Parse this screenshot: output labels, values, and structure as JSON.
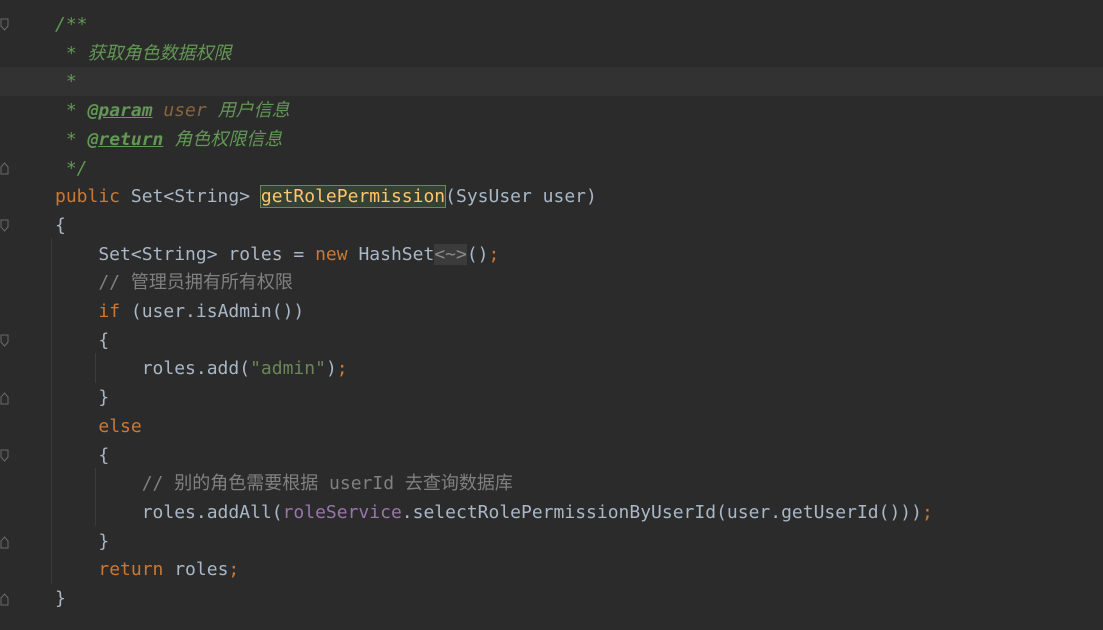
{
  "editor": {
    "lines": [
      {
        "tokens": [
          {
            "t": "/**",
            "c": "doc"
          }
        ]
      },
      {
        "tokens": [
          {
            "t": " * 获取角色数据权限",
            "c": "doc"
          }
        ]
      },
      {
        "tokens": [
          {
            "t": " *",
            "c": "doc"
          }
        ]
      },
      {
        "tokens": [
          {
            "t": " * ",
            "c": "doc"
          },
          {
            "t": "@param",
            "c": "doc-tag"
          },
          {
            "t": " user",
            "c": "doc-param"
          },
          {
            "t": " 用户信息",
            "c": "doc"
          }
        ]
      },
      {
        "tokens": [
          {
            "t": " * ",
            "c": "doc"
          },
          {
            "t": "@return",
            "c": "doc-tag"
          },
          {
            "t": " 角色权限信息",
            "c": "doc"
          }
        ]
      },
      {
        "tokens": [
          {
            "t": " */",
            "c": "doc"
          }
        ]
      },
      {
        "tokens": [
          {
            "t": "public ",
            "c": "kw"
          },
          {
            "t": "Set<String> ",
            "c": "plain"
          },
          {
            "t": "getRolePermission",
            "c": "method-hl"
          },
          {
            "t": "(SysUser user)",
            "c": "plain"
          }
        ]
      },
      {
        "tokens": [
          {
            "t": "{",
            "c": "plain"
          }
        ]
      },
      {
        "tokens": [
          {
            "t": "    Set<String> roles = ",
            "c": "plain"
          },
          {
            "t": "new ",
            "c": "kw"
          },
          {
            "t": "HashSet",
            "c": "plain"
          },
          {
            "t": "<~>",
            "c": "diamond"
          },
          {
            "t": "()",
            "c": "plain"
          },
          {
            "t": ";",
            "c": "semi"
          }
        ]
      },
      {
        "tokens": [
          {
            "t": "    // 管理员拥有所有权限",
            "c": "comment"
          }
        ]
      },
      {
        "tokens": [
          {
            "t": "    ",
            "c": "plain"
          },
          {
            "t": "if ",
            "c": "kw"
          },
          {
            "t": "(user.isAdmin())",
            "c": "plain"
          }
        ]
      },
      {
        "tokens": [
          {
            "t": "    {",
            "c": "plain"
          }
        ]
      },
      {
        "tokens": [
          {
            "t": "        roles.add(",
            "c": "plain"
          },
          {
            "t": "\"admin\"",
            "c": "str"
          },
          {
            "t": ")",
            "c": "plain"
          },
          {
            "t": ";",
            "c": "semi"
          }
        ]
      },
      {
        "tokens": [
          {
            "t": "    }",
            "c": "plain"
          }
        ]
      },
      {
        "tokens": [
          {
            "t": "    ",
            "c": "plain"
          },
          {
            "t": "else",
            "c": "kw"
          }
        ]
      },
      {
        "tokens": [
          {
            "t": "    {",
            "c": "plain"
          }
        ]
      },
      {
        "tokens": [
          {
            "t": "        // 别的角色需要根据 userId 去查询数据库",
            "c": "comment"
          }
        ]
      },
      {
        "tokens": [
          {
            "t": "        roles.addAll(",
            "c": "plain"
          },
          {
            "t": "roleService",
            "c": "field"
          },
          {
            "t": ".selectRolePermissionByUserId(user.getUserId()))",
            "c": "plain"
          },
          {
            "t": ";",
            "c": "semi"
          }
        ]
      },
      {
        "tokens": [
          {
            "t": "    }",
            "c": "plain"
          }
        ]
      },
      {
        "tokens": [
          {
            "t": "    ",
            "c": "plain"
          },
          {
            "t": "return ",
            "c": "kw"
          },
          {
            "t": "roles",
            "c": "plain"
          },
          {
            "t": ";",
            "c": "semi"
          }
        ]
      },
      {
        "tokens": [
          {
            "t": "}",
            "c": "plain"
          }
        ]
      }
    ]
  }
}
